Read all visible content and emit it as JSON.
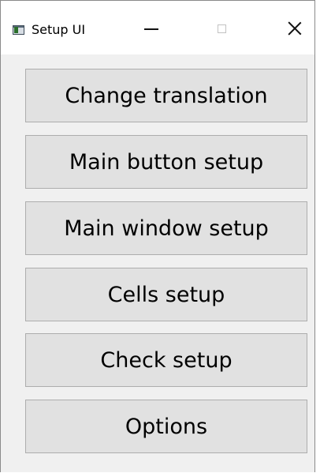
{
  "window": {
    "title": "Setup UI",
    "controls": {
      "minimize": "minimize-icon",
      "maximize": "maximize-icon",
      "close": "close-icon"
    }
  },
  "buttons": [
    {
      "label": "Change translation"
    },
    {
      "label": "Main button setup"
    },
    {
      "label": "Main window setup"
    },
    {
      "label": "Cells setup"
    },
    {
      "label": "Check setup"
    },
    {
      "label": "Options"
    }
  ],
  "colors": {
    "window_background": "#f0f0f0",
    "titlebar_background": "#ffffff",
    "button_face": "#e1e1e1",
    "button_border": "#adadad",
    "text": "#000000"
  }
}
